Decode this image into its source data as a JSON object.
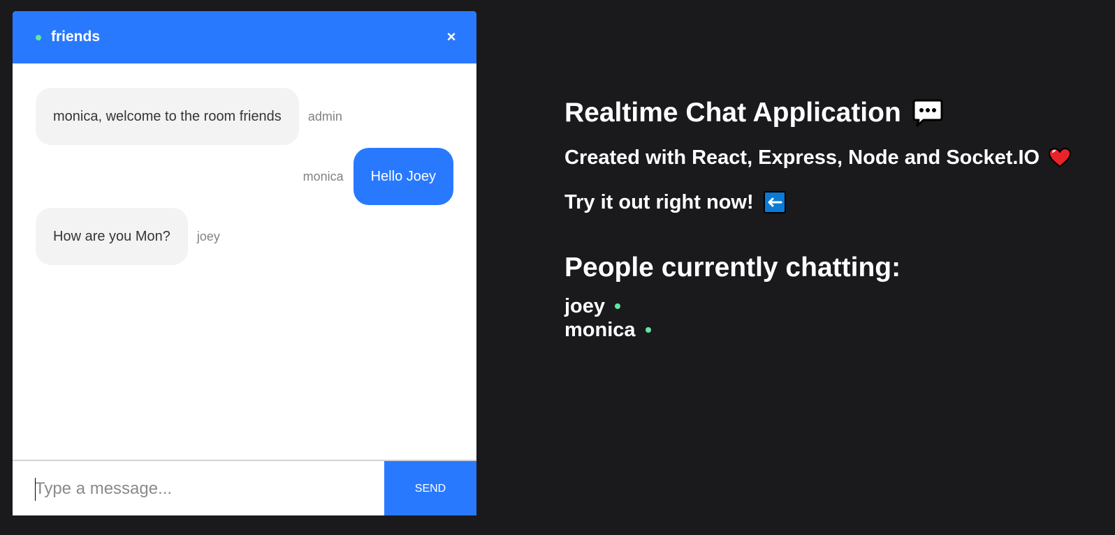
{
  "chat": {
    "room_name": "friends",
    "close_label": "×",
    "messages": [
      {
        "text": "monica, welcome to the room friends",
        "sender": "admin",
        "own": false
      },
      {
        "text": "Hello Joey",
        "sender": "monica",
        "own": true
      },
      {
        "text": "How are you Mon?",
        "sender": "joey",
        "own": false
      }
    ],
    "input": {
      "value": "",
      "placeholder": "Type a message..."
    },
    "send_label": "SEND"
  },
  "info": {
    "title": "Realtime Chat Application",
    "title_icon": "speech-bubble-icon",
    "created_with": "Created with React, Express, Node and Socket.IO",
    "created_icon": "heart-icon",
    "try_it": "Try it out right now!",
    "try_icon": "left-arrow-icon",
    "people_title": "People currently chatting:",
    "people": [
      "joey",
      "monica"
    ]
  },
  "colors": {
    "accent": "#2979ff",
    "background": "#1a1a1d",
    "online": "#60e8a2"
  }
}
